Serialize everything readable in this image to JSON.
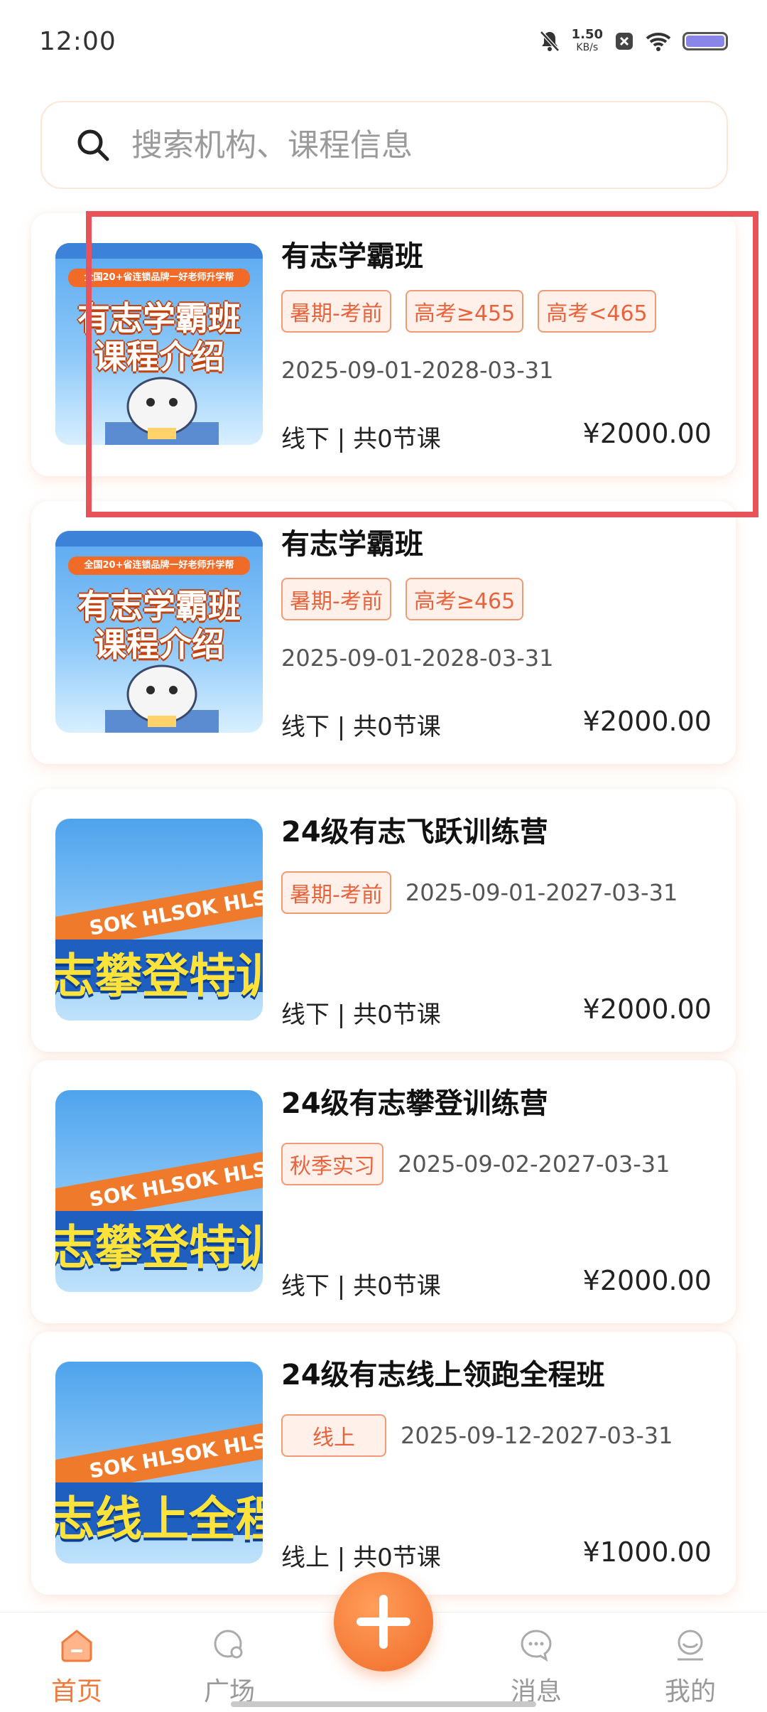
{
  "status_bar": {
    "time": "12:00",
    "net_speed_value": "1.50",
    "net_speed_unit": "KB/s"
  },
  "search": {
    "placeholder": "搜索机构、课程信息"
  },
  "courses": [
    {
      "title": "有志学霸班",
      "tags": [
        "暑期-考前",
        "高考≥455",
        "高考<465"
      ],
      "date": "2025-09-01-2028-03-31",
      "meta": "线下 | 共0节课",
      "price": "¥2000.00",
      "thumb_text": [
        "有志学霸班",
        "课程介绍"
      ],
      "thumb_banner": "全国20+省连锁品牌一好老师升学帮"
    },
    {
      "title": "有志学霸班",
      "tags": [
        "暑期-考前",
        "高考≥465"
      ],
      "date": "2025-09-01-2028-03-31",
      "meta": "线下 | 共0节课",
      "price": "¥2000.00",
      "thumb_text": [
        "有志学霸班",
        "课程介绍"
      ],
      "thumb_banner": "全国20+省连锁品牌一好老师升学帮"
    },
    {
      "title": "24级有志飞跃训练营",
      "tags": [
        "暑期-考前"
      ],
      "date": "2025-09-01-2027-03-31",
      "meta": "线下 | 共0节课",
      "price": "¥2000.00",
      "thumb_ribbon": "SOK HLSOK HLS",
      "thumb_text": [
        "志攀登特训"
      ]
    },
    {
      "title": "24级有志攀登训练营",
      "tags": [
        "秋季实习"
      ],
      "date": "2025-09-02-2027-03-31",
      "meta": "线下 | 共0节课",
      "price": "¥2000.00",
      "thumb_ribbon": "SOK HLSOK HLS",
      "thumb_text": [
        "志攀登特训"
      ]
    },
    {
      "title": "24级有志线上领跑全程班",
      "tags": [
        "线上"
      ],
      "date": "2025-09-12-2027-03-31",
      "meta": "线上 | 共0节课",
      "price": "¥1000.00",
      "thumb_ribbon": "SOK HLSOK HLS",
      "thumb_text": [
        "志线上全程"
      ]
    }
  ],
  "bottom_nav": [
    {
      "label": "首页",
      "icon": "home-icon",
      "active": true
    },
    {
      "label": "广场",
      "icon": "plaza-icon",
      "active": false
    },
    {
      "label": "",
      "icon": "plus-icon",
      "active": false
    },
    {
      "label": "消息",
      "icon": "message-icon",
      "active": false
    },
    {
      "label": "我的",
      "icon": "profile-icon",
      "active": false
    }
  ],
  "colors": {
    "accent": "#f07a3c",
    "tag_text": "#e8623c",
    "tag_border": "#f09a78",
    "tag_bg": "#fff1ea",
    "highlight": "#e8535a"
  }
}
